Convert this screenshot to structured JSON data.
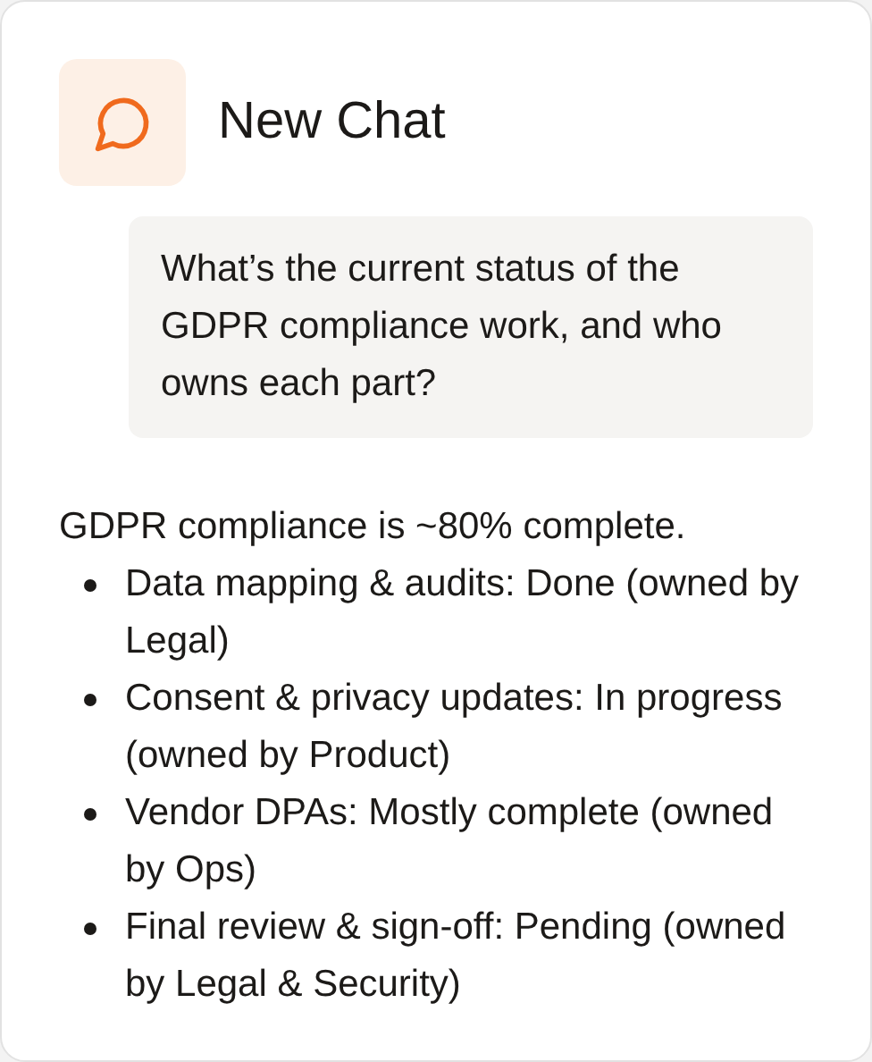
{
  "header": {
    "title": "New Chat"
  },
  "user_message": "What’s the current status of the GDPR compliance work, and who owns each part?",
  "reply": {
    "intro": "GDPR compliance is ~80% complete.",
    "items": [
      "Data mapping & audits: Done (owned by Legal)",
      "Consent & privacy updates: In progress (owned by Product)",
      "Vendor DPAs: Mostly complete (owned by Ops)",
      "Final review & sign-off: Pending (owned by Legal & Security)"
    ]
  }
}
